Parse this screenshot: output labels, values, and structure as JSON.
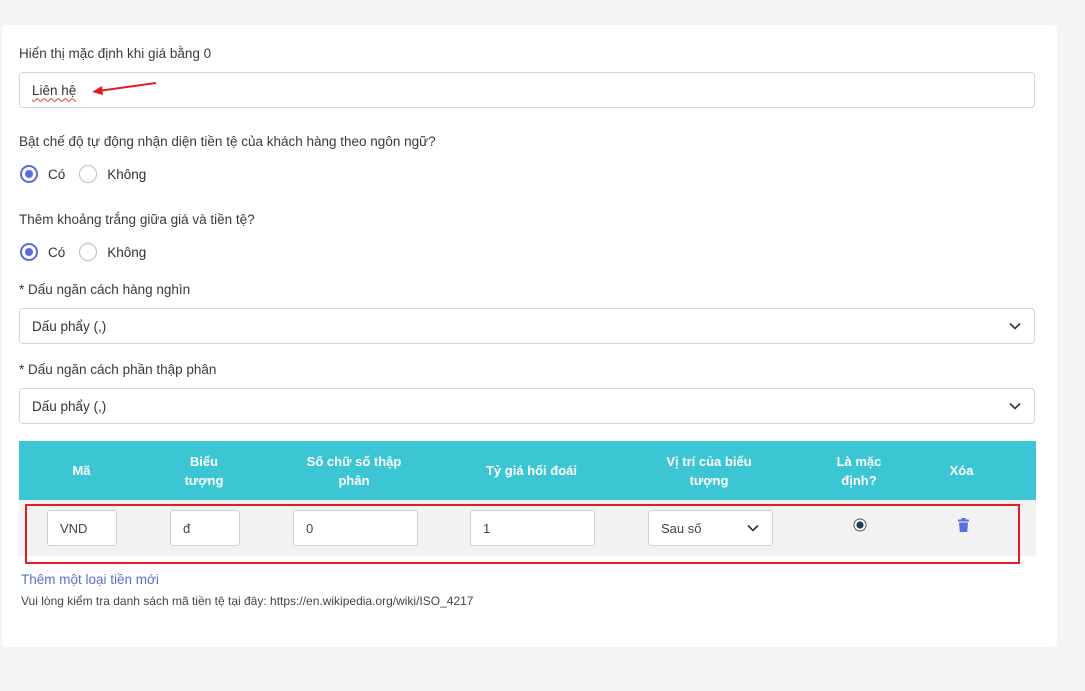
{
  "form": {
    "zero_price_label": "Hiển thị mặc định khi giá bằng 0",
    "zero_price_value": "Liên hệ",
    "auto_detect_label": "Bật chế độ tự động nhận diện tiền tệ của khách hàng theo ngôn ngữ?",
    "auto_detect": {
      "yes": "Có",
      "no": "Không",
      "selected": "Có"
    },
    "space_label": "Thêm khoảng trắng giữa giá và tiền tệ?",
    "space": {
      "yes": "Có",
      "no": "Không",
      "selected": "Có"
    },
    "thousand_sep_label": "* Dấu ngăn cách hàng nghìn",
    "thousand_sep_value": "Dấu phẩy (,)",
    "decimal_sep_label": "* Dấu ngăn cách phần thập phân",
    "decimal_sep_value": "Dấu phẩy (,)"
  },
  "table": {
    "headers": {
      "code": "Mã",
      "symbol_1": "Biểu",
      "symbol_2": "tượng",
      "decimals_1": "Số chữ số thập",
      "decimals_2": "phân",
      "rate": "Tỷ giá hối đoái",
      "position_1": "Vị trí của biểu",
      "position_2": "tượng",
      "default_1": "Là mặc",
      "default_2": "định?",
      "delete": "Xóa"
    },
    "rows": [
      {
        "code": "VND",
        "symbol": "đ",
        "decimals": "0",
        "rate": "1",
        "position": "Sau số",
        "is_default": true
      }
    ]
  },
  "add_currency_link": "Thêm một loại tiền mới",
  "iso_note": "Vui lòng kiểm tra danh sách mã tiền tệ tại đây: https://en.wikipedia.org/wiki/ISO_4217",
  "colors": {
    "header_bg": "#3cc5d3",
    "accent": "#5b6be0",
    "annotation": "#e31c23"
  },
  "icons": {
    "select_arrow": "chevron-down-icon",
    "delete": "trash-icon",
    "pointer": "arrow-annotation-icon"
  }
}
